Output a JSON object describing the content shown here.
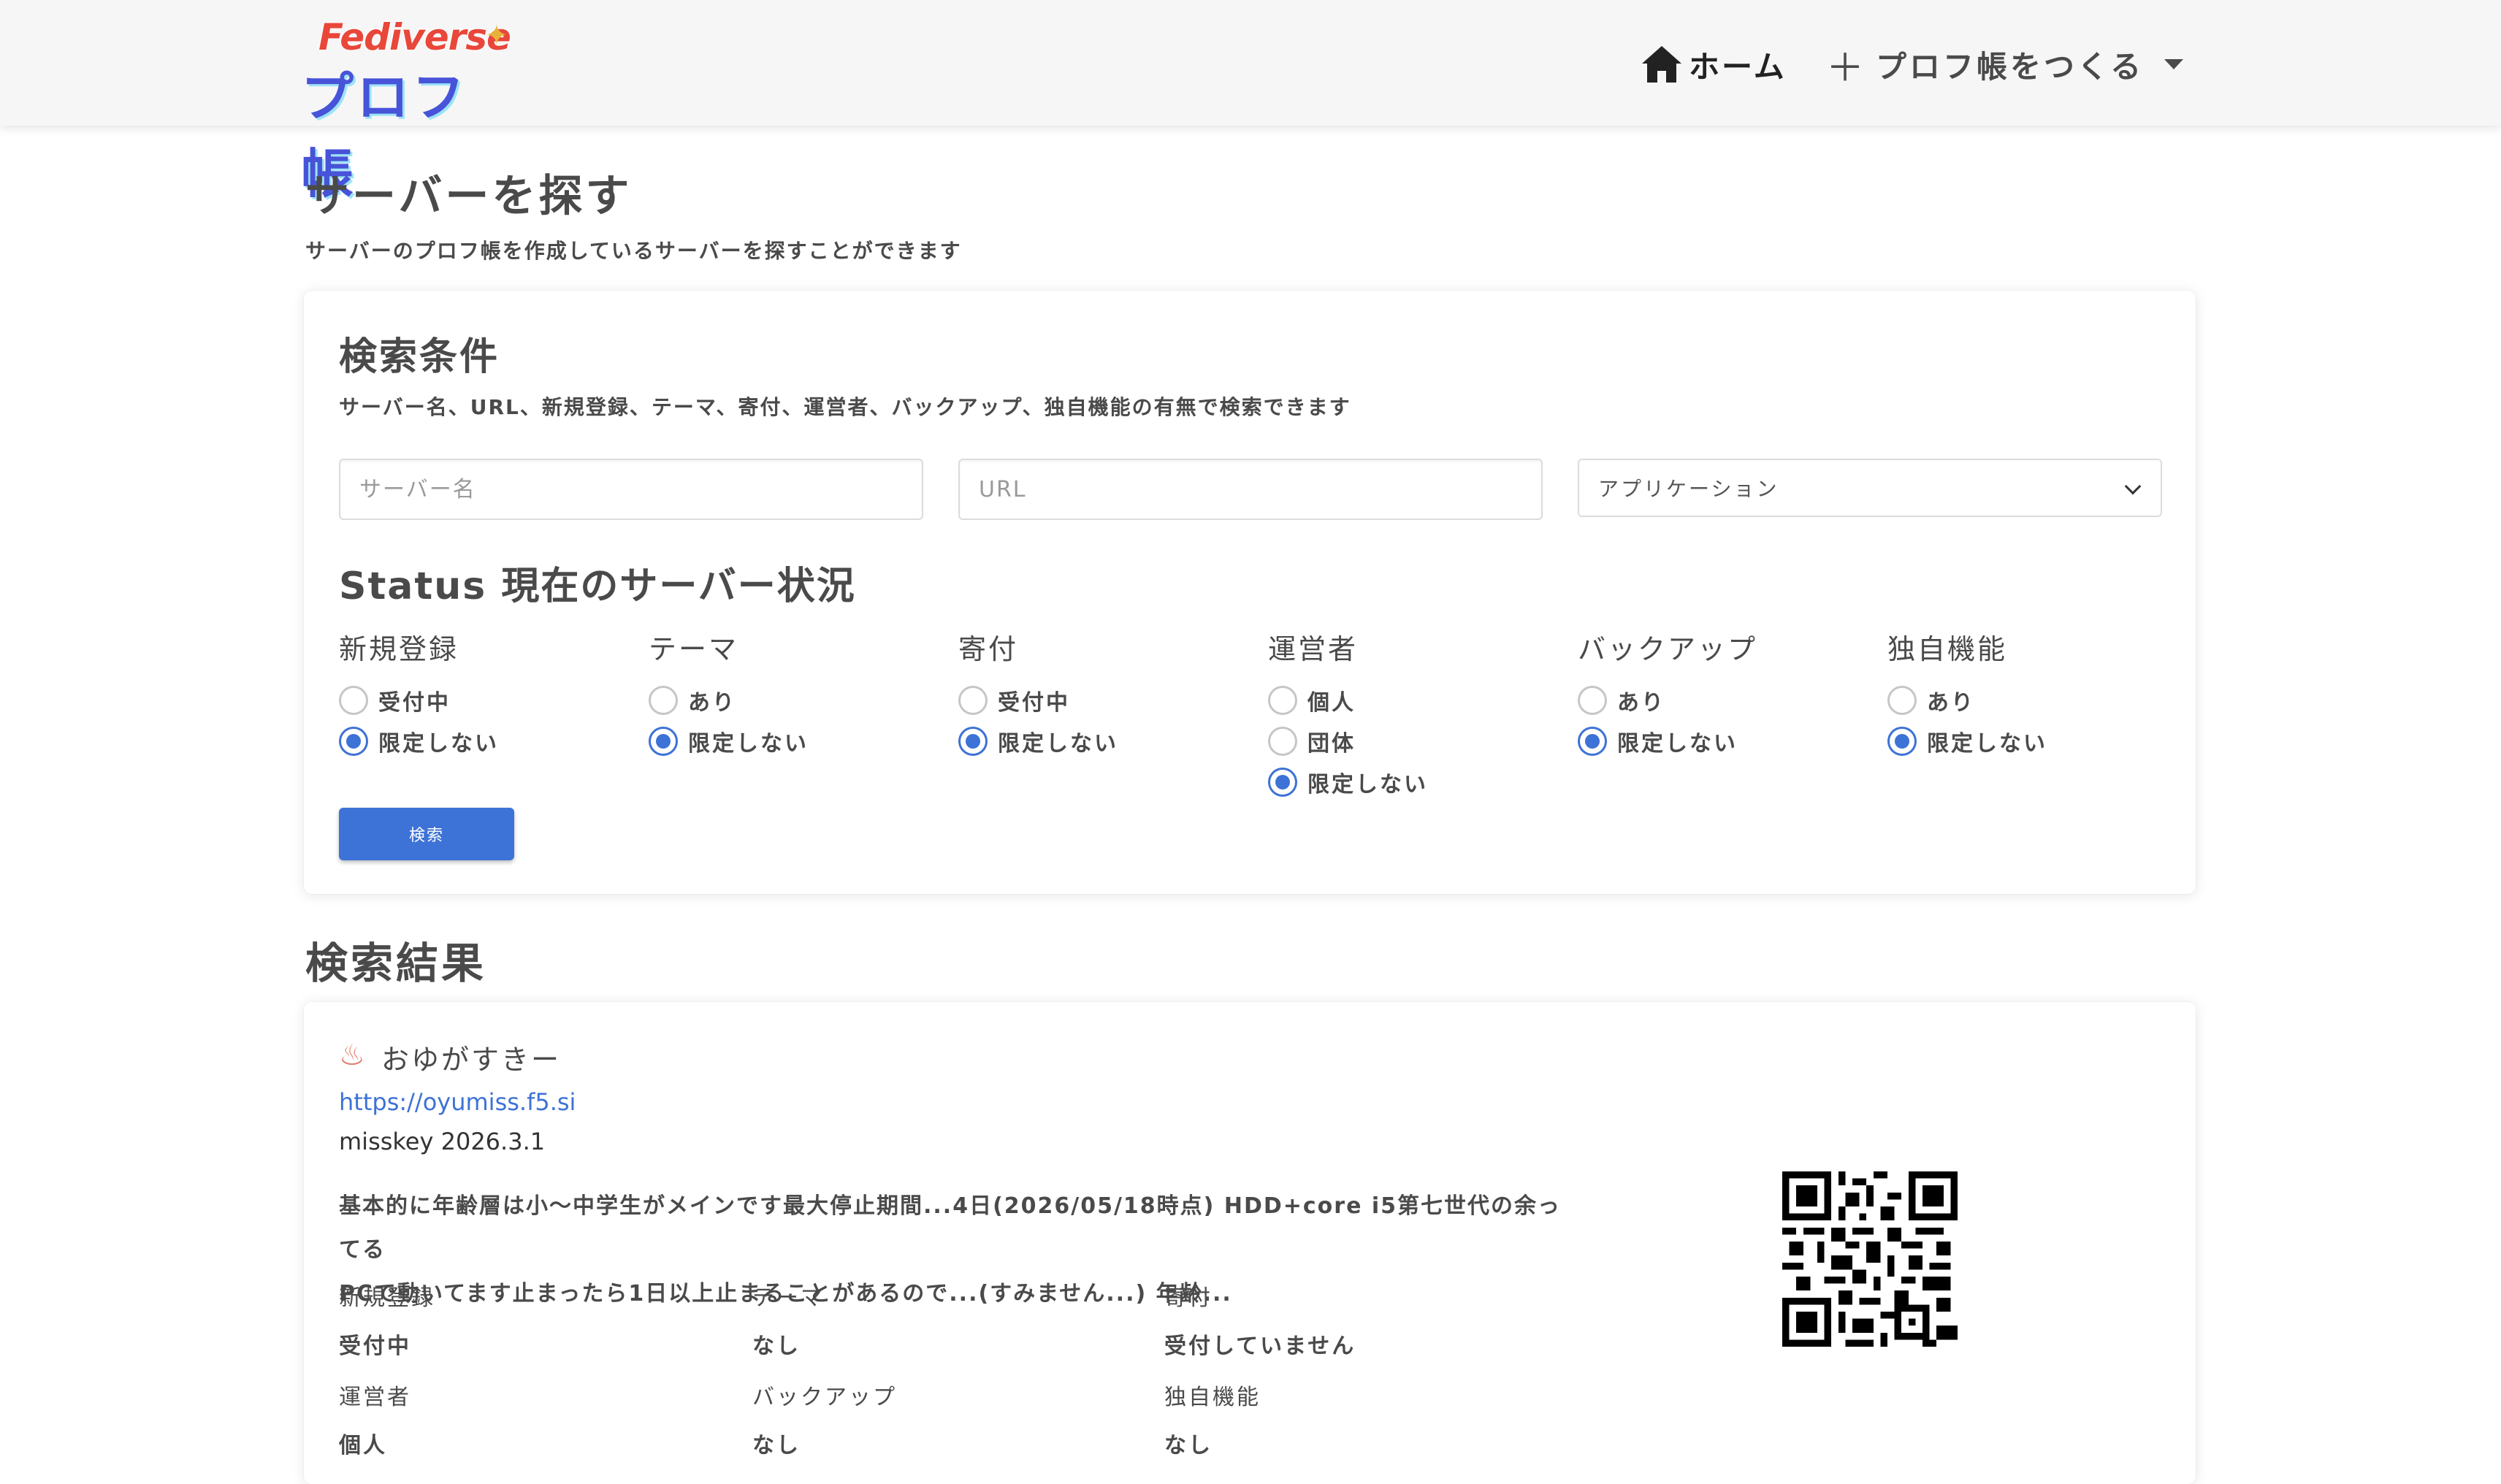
{
  "header": {
    "logo_top": "Fediverse",
    "logo_bottom": "プロフ帳",
    "home_label": "ホーム",
    "make_label": "プロフ帳をつくる"
  },
  "page": {
    "title": "サーバーを探す",
    "subtitle": "サーバーのプロフ帳を作成しているサーバーを探すことができます"
  },
  "search": {
    "title": "検索条件",
    "description": "サーバー名、URL、新規登録、テーマ、寄付、運営者、バックアップ、独自機能の有無で検索できます",
    "name_placeholder": "サーバー名",
    "url_placeholder": "URL",
    "app_select": "アプリケーション",
    "status_title": "Status 現在のサーバー状況",
    "groups": [
      {
        "label": "新規登録",
        "options": [
          {
            "label": "受付中",
            "checked": false
          },
          {
            "label": "限定しない",
            "checked": true
          }
        ]
      },
      {
        "label": "テーマ",
        "options": [
          {
            "label": "あり",
            "checked": false
          },
          {
            "label": "限定しない",
            "checked": true
          }
        ]
      },
      {
        "label": "寄付",
        "options": [
          {
            "label": "受付中",
            "checked": false
          },
          {
            "label": "限定しない",
            "checked": true
          }
        ]
      },
      {
        "label": "運営者",
        "options": [
          {
            "label": "個人",
            "checked": false
          },
          {
            "label": "団体",
            "checked": false
          },
          {
            "label": "限定しない",
            "checked": true
          }
        ]
      },
      {
        "label": "バックアップ",
        "options": [
          {
            "label": "あり",
            "checked": false
          },
          {
            "label": "限定しない",
            "checked": true
          }
        ]
      },
      {
        "label": "独自機能",
        "options": [
          {
            "label": "あり",
            "checked": false
          },
          {
            "label": "限定しない",
            "checked": true
          }
        ]
      }
    ],
    "button_label": "検索"
  },
  "results": {
    "title": "検索結果",
    "items": [
      {
        "icon": "hot-spring-icon",
        "name": "おゆがすきー",
        "url": "https://oyumiss.f5.si",
        "version": "misskey 2026.3.1",
        "description_line1": "基本的に年齢層は小〜中学生がメインです最大停止期間...4日(2026/05/18時点) HDD+core i5第七世代の余ってる",
        "description_line2": "PCで動いてます止まったら1日以上止まることがあるので...(すみません...) 年齢...",
        "attrs": [
          {
            "label": "新規登録",
            "value": "受付中"
          },
          {
            "label": "テーマ",
            "value": "なし"
          },
          {
            "label": "寄付",
            "value": "受付していません"
          },
          {
            "label": "運営者",
            "value": "個人"
          },
          {
            "label": "バックアップ",
            "value": "なし"
          },
          {
            "label": "独自機能",
            "value": "なし"
          }
        ]
      }
    ]
  },
  "colors": {
    "accent": "#3d72d6",
    "text": "#4a4a4a",
    "navbar_bg": "#f6f6f6"
  }
}
